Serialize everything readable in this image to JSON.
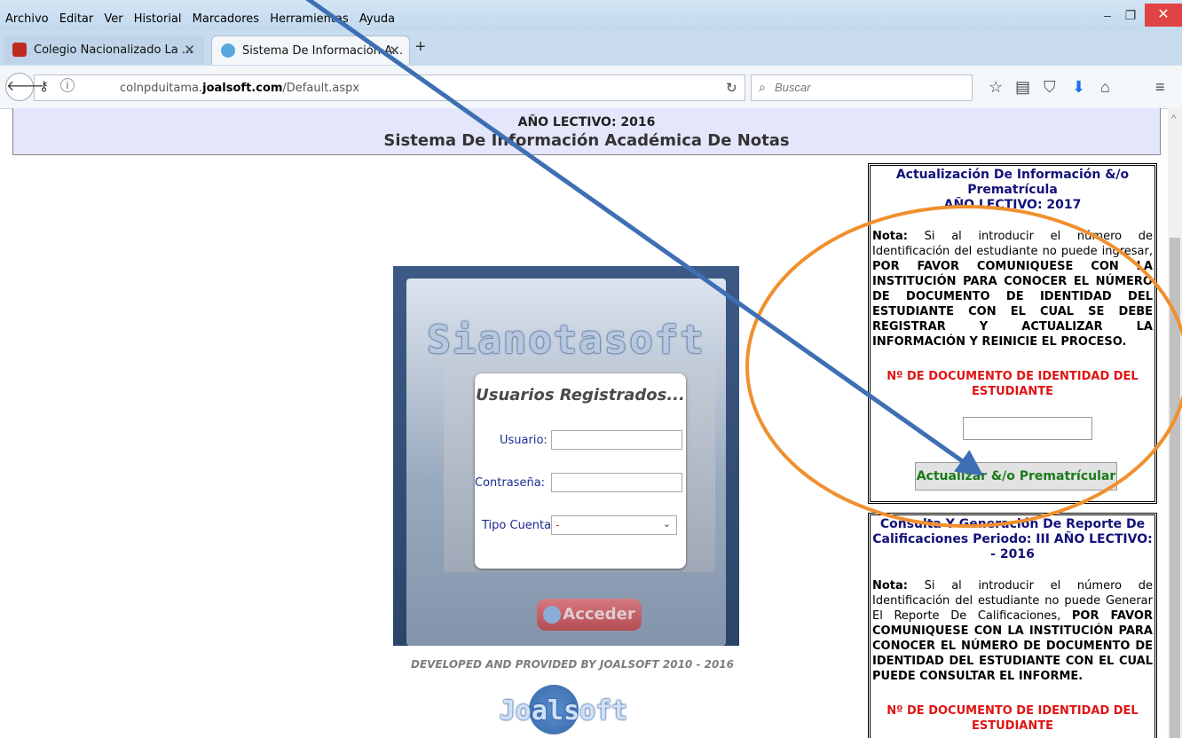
{
  "menu": [
    "Archivo",
    "Editar",
    "Ver",
    "Historial",
    "Marcadores",
    "Herramientas",
    "Ayuda"
  ],
  "window_controls": {
    "minimize": "–",
    "maximize": "❐",
    "close": "✕"
  },
  "tabs": [
    {
      "title": "Colegio Nacionalizado La ...",
      "close": "✕"
    },
    {
      "title": "Sistema De Información A...",
      "close": "✕"
    }
  ],
  "new_tab": "+",
  "address": {
    "prefix": "colnpduitama.",
    "domain": "joalsoft.com",
    "path": "/Default.aspx"
  },
  "search_placeholder": "Buscar",
  "header": {
    "year": "AÑO LECTIVO: 2016",
    "title": "Sistema De Información Académica De Notas"
  },
  "login": {
    "brand": "Sianotasoft",
    "heading": "Usuarios Registrados...",
    "user_label": "Usuario:",
    "pass_label": "Contraseña:",
    "type_label": "Tipo Cuenta:",
    "type_value": "-",
    "submit": "Acceder"
  },
  "footer": {
    "developed": "DEVELOPED AND PROVIDED BY JOALSOFT 2010 - 2016",
    "logo": "Joalsoft"
  },
  "update_box": {
    "title1": "Actualización De Información &/o Prematrícula",
    "title2": "AÑO LECTIVO: 2017",
    "note_label": "Nota:",
    "note_text": " Si al introducir el número de Identificación del estudiante no puede ingresar, ",
    "note_bold": "POR FAVOR COMUNIQUESE CON LA INSTITUCIÓN PARA CONOCER EL NÚMERO DE DOCUMENTO DE IDENTIDAD DEL ESTUDIANTE CON EL CUAL SE DEBE REGISTRAR Y ACTUALIZAR LA INFORMACIÓN Y REINICIE EL PROCESO.",
    "id_label": "Nº DE DOCUMENTO DE IDENTIDAD DEL ESTUDIANTE",
    "button": "Actualizar &/o Prematrícular"
  },
  "report_box": {
    "title": "Consulta Y Generación De Reporte De Calificaciones Periodo: III AÑO LECTIVO: - 2016",
    "note_label": "Nota:",
    "note_text": " Si al introducir el número de Identificación del estudiante no puede Generar El Reporte De Calificaciones, ",
    "note_bold": "POR FAVOR COMUNIQUESE CON LA INSTITUCIÓN PARA CONOCER EL NÚMERO DE DOCUMENTO DE IDENTIDAD DEL ESTUDIANTE CON EL CUAL PUEDE CONSULTAR EL INFORME.",
    "id_label": "Nº DE DOCUMENTO DE IDENTIDAD DEL ESTUDIANTE"
  },
  "colors": {
    "arrow": "#3e6fb4",
    "ellipse": "#f0902e",
    "close_button": "#e04343"
  }
}
